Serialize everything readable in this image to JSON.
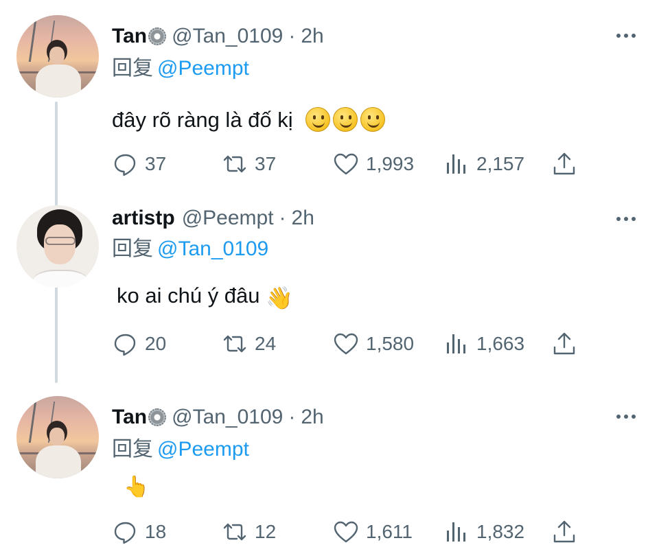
{
  "tweets": [
    {
      "name": "Tan",
      "handle": "@Tan_0109",
      "separator": "·",
      "time": "2h",
      "reply_prefix": "回复",
      "reply_to": "@Peempt",
      "text": "đây rõ ràng là đố kị",
      "emoji": "smiling-face-icon x3",
      "counts": {
        "replies": "37",
        "retweets": "37",
        "likes": "1,993",
        "views": "2,157"
      }
    },
    {
      "name": "artistp",
      "handle": "@Peempt",
      "separator": "·",
      "time": "2h",
      "reply_prefix": "回复",
      "reply_to": "@Tan_0109",
      "text": "ko ai chú ý đâu",
      "emoji": "waving-hand-icon",
      "counts": {
        "replies": "20",
        "retweets": "24",
        "likes": "1,580",
        "views": "1,663"
      }
    },
    {
      "name": "Tan",
      "handle": "@Tan_0109",
      "separator": "·",
      "time": "2h",
      "reply_prefix": "回复",
      "reply_to": "@Peempt",
      "text": "",
      "emoji": "pointing-up-icon",
      "counts": {
        "replies": "18",
        "retweets": "12",
        "likes": "1,611",
        "views": "1,832"
      }
    }
  ],
  "colors": {
    "link": "#1d9bf0",
    "secondary_text": "#536471",
    "primary_text": "#0f1419",
    "thread_line": "#cfd9de"
  },
  "glyphs": {
    "wave": "👋",
    "point_up": "👆"
  }
}
